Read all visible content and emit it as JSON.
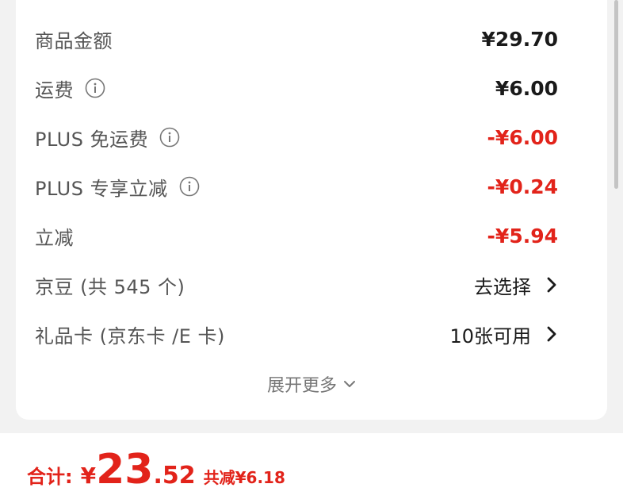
{
  "summary": {
    "rows": [
      {
        "label": "商品金额",
        "value": "¥29.70"
      },
      {
        "label": "运费",
        "value": "¥6.00"
      },
      {
        "label": "PLUS 免运费",
        "value": "-¥6.00"
      },
      {
        "label": "PLUS 专享立减",
        "value": "-¥0.24"
      },
      {
        "label": "立减",
        "value": "-¥5.94"
      },
      {
        "label": "京豆 (共 545 个)",
        "value": "去选择"
      },
      {
        "label": "礼品卡 (京东卡 /E 卡)",
        "value": "10张可用"
      }
    ],
    "expand_label": "展开更多"
  },
  "footer": {
    "total_label": "合计:",
    "currency": "¥",
    "total_integer": "23",
    "total_decimal": ".52",
    "saving_text": "共减¥6.18"
  },
  "colors": {
    "accent_red": "#e2231a",
    "label_gray": "#555555",
    "value_black": "#1a1a1a"
  },
  "icons": [
    "info-icon",
    "chevron-right-icon",
    "chevron-down-icon"
  ]
}
